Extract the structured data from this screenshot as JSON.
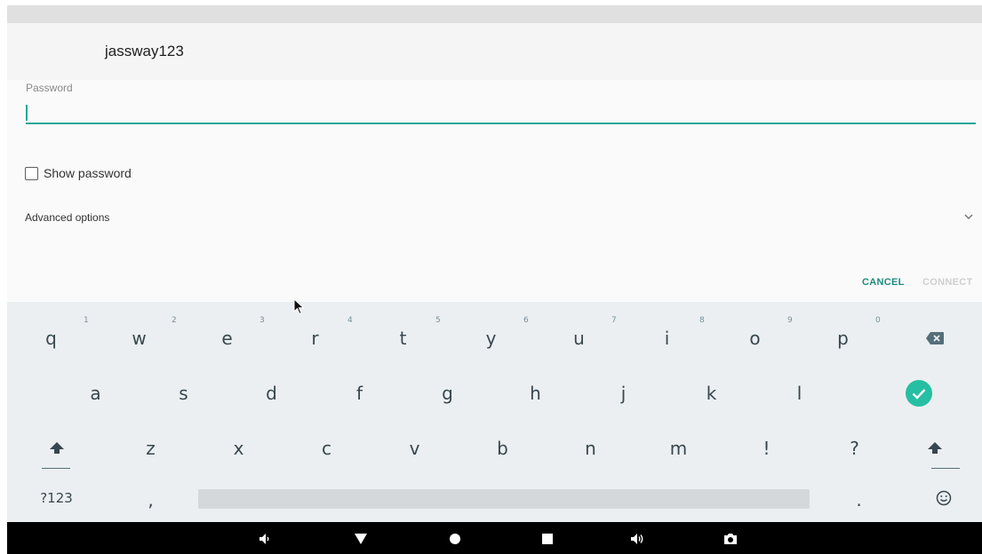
{
  "header": {
    "network_name": "jassway123"
  },
  "password": {
    "label": "Password",
    "value": ""
  },
  "show_password": {
    "label": "Show password",
    "checked": false
  },
  "advanced": {
    "label": "Advanced options",
    "icon": "chevron-down-icon"
  },
  "actions": {
    "cancel": "CANCEL",
    "connect": "CONNECT"
  },
  "keyboard": {
    "row1": [
      {
        "key": "q",
        "hint": "1"
      },
      {
        "key": "w",
        "hint": "2"
      },
      {
        "key": "e",
        "hint": "3"
      },
      {
        "key": "r",
        "hint": "4"
      },
      {
        "key": "t",
        "hint": "5"
      },
      {
        "key": "y",
        "hint": "6"
      },
      {
        "key": "u",
        "hint": "7"
      },
      {
        "key": "i",
        "hint": "8"
      },
      {
        "key": "o",
        "hint": "9"
      },
      {
        "key": "p",
        "hint": "0"
      }
    ],
    "row2": [
      "a",
      "s",
      "d",
      "f",
      "g",
      "h",
      "j",
      "k",
      "l"
    ],
    "row3": [
      "z",
      "x",
      "c",
      "v",
      "b",
      "n",
      "m",
      "!",
      "?"
    ],
    "row4": {
      "symbols": "?123",
      "comma": ",",
      "period": "."
    },
    "icons": {
      "backspace": "backspace-icon",
      "enter": "done-check-icon",
      "shift": "shift-icon",
      "emoji": "emoji-icon"
    }
  },
  "navbar": {
    "icons": [
      "volume-down-icon",
      "back-icon",
      "home-icon",
      "recents-icon",
      "volume-up-icon",
      "screenshot-icon"
    ]
  },
  "colors": {
    "accent": "#26a69a",
    "keyboard_bg": "#eceff1",
    "navbar_bg": "#000000"
  }
}
